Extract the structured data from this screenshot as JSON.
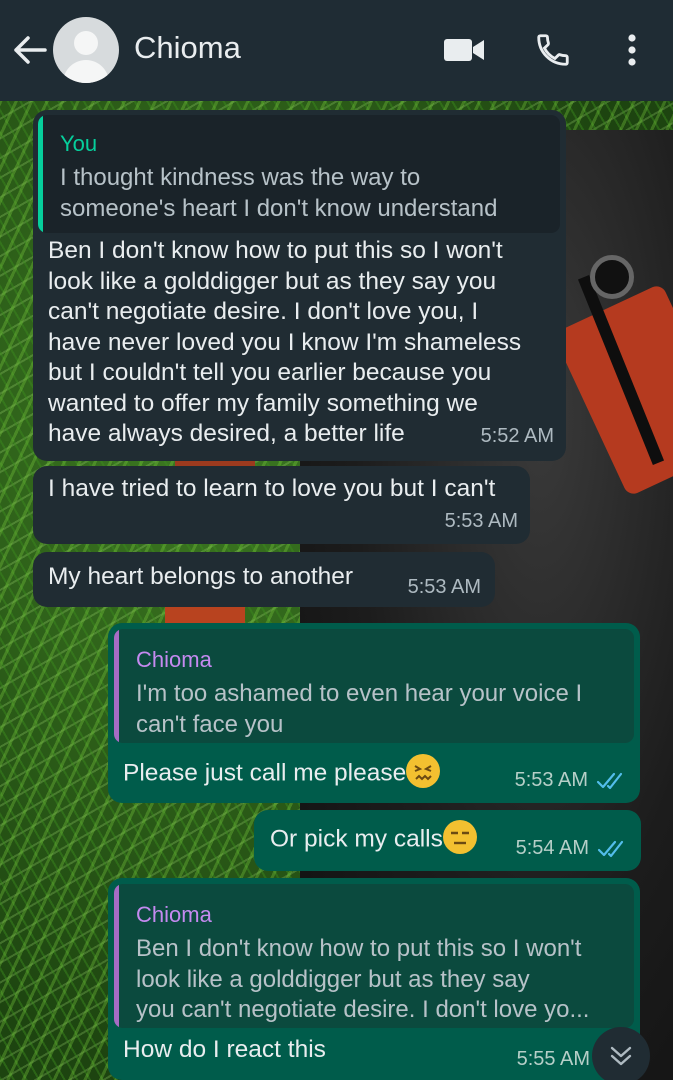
{
  "header": {
    "contact_name": "Chioma",
    "icons": [
      "back-arrow-icon",
      "avatar",
      "video-call-icon",
      "voice-call-icon",
      "more-options-icon"
    ]
  },
  "colors": {
    "header_bg": "#1f2c34",
    "incoming_bubble": "#202c33",
    "outgoing_bubble": "#005c4b",
    "quote_bar_you": "#06cf9c",
    "quote_bar_contact": "#a66cc5",
    "read_ticks": "#53bdeb"
  },
  "messages": [
    {
      "direction": "incoming",
      "quote": {
        "author": "You",
        "lines": [
          "I thought kindness was the way to",
          "someone's heart I don't know understand"
        ]
      },
      "lines": [
        "Ben I don't know how to put this so I won't",
        "look like a golddigger but as they say you",
        "can't negotiate desire. I don't love you, I",
        "have never loved you I know I'm shameless",
        "but I couldn't tell you earlier because you",
        "wanted to offer my family something we",
        "have always desired, a better life"
      ],
      "time": "5:52 AM"
    },
    {
      "direction": "incoming",
      "lines": [
        "I have tried to learn to love you but I can't"
      ],
      "time": "5:53 AM"
    },
    {
      "direction": "incoming",
      "lines": [
        "My heart belongs to another"
      ],
      "time": "5:53 AM"
    },
    {
      "direction": "outgoing",
      "quote": {
        "author": "Chioma",
        "lines": [
          "I'm too ashamed to even hear your voice I",
          "can't face you"
        ]
      },
      "lines": [
        "Please just call me please"
      ],
      "emoji": "confounded-face",
      "time": "5:53 AM",
      "status": "read"
    },
    {
      "direction": "outgoing",
      "lines": [
        "Or pick my calls"
      ],
      "emoji": "expressionless-face",
      "time": "5:54 AM",
      "status": "read"
    },
    {
      "direction": "outgoing",
      "quote": {
        "author": "Chioma",
        "lines": [
          "Ben I don't know how to put this so I won't",
          "look like a golddigger but as they say",
          "you can't negotiate desire. I don't love yo..."
        ]
      },
      "lines": [
        "How do I react this"
      ],
      "time": "5:55 AM"
    }
  ],
  "scroll_button": {
    "icon": "double-chevron-down-icon"
  }
}
